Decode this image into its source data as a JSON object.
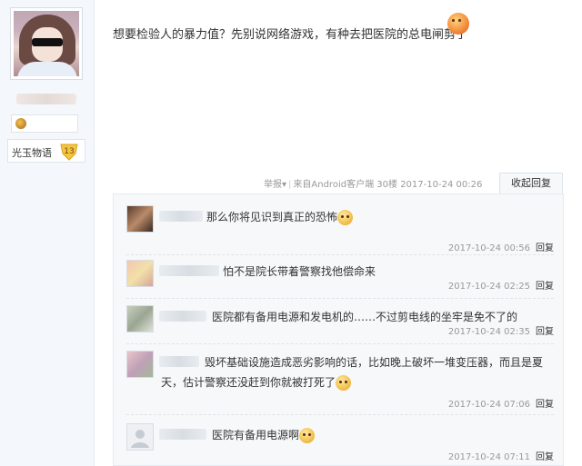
{
  "author": {
    "level_label": "光玉物语",
    "level_number": "13"
  },
  "post": {
    "text": "想要检验人的暴力值？先别说网络游戏，有种去把医院的总电闸剪了"
  },
  "meta": {
    "report": "举报",
    "source": "来自Android客户端",
    "floor": "30楼",
    "time": "2017-10-24 00:26",
    "collapse": "收起回复"
  },
  "replies": [
    {
      "text": "那么你将见识到真正的恐怖",
      "time": "2017-10-24 00:56",
      "reply_label": "回复"
    },
    {
      "text": "怕不是院长带着警察找他偿命来",
      "time": "2017-10-24 02:25",
      "reply_label": "回复"
    },
    {
      "text": "医院都有备用电源和发电机的……不过剪电线的坐牢是免不了的",
      "time": "2017-10-24 02:35",
      "reply_label": "回复"
    },
    {
      "text_line1": "毁坏基础设施造成恶劣影响的话，比如晚上破坏一堆变压器，而且是夏",
      "text_line2": "天，估计警察还没赶到你就被打死了",
      "time": "2017-10-24 07:06",
      "reply_label": "回复"
    },
    {
      "text": "医院有备用电源啊",
      "time": "2017-10-24 07:11",
      "reply_label": "回复"
    }
  ],
  "colors": {
    "sidebar_bg": "#f4f8fc",
    "reply_area_bg": "#f7f8fa",
    "meta_text": "#999999",
    "level_badge": "#f5c542"
  },
  "icons": {
    "post_emoji": "angry-face-icon",
    "reply_emoji": "grin-face-icon",
    "level_badge": "level-shield-icon"
  }
}
